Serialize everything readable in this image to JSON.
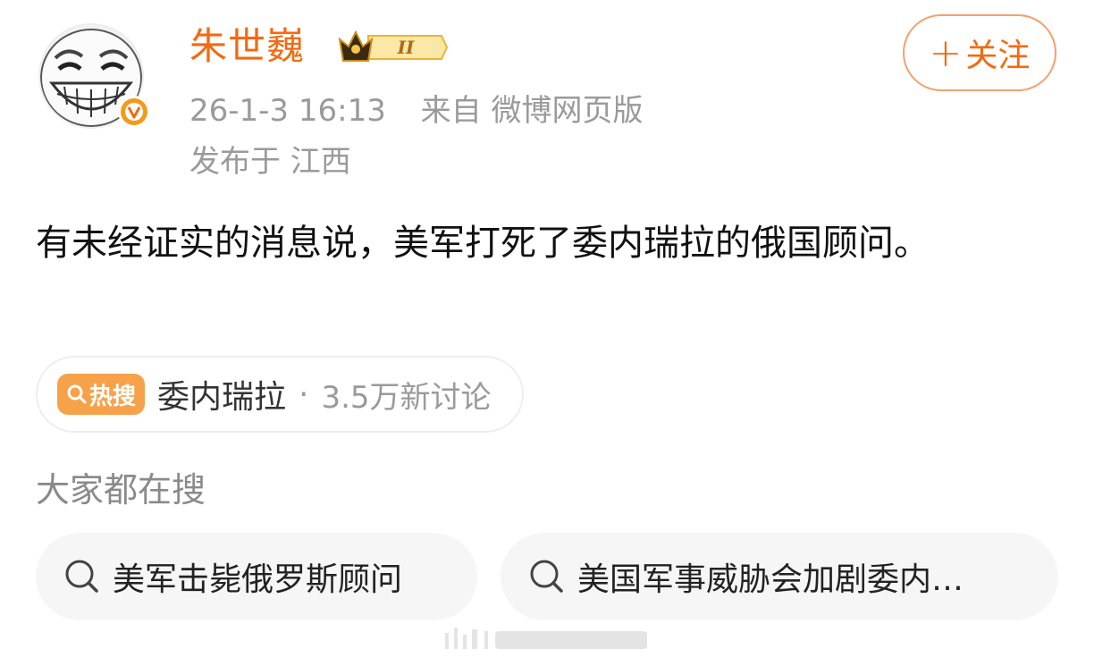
{
  "user": {
    "name": "朱世巍",
    "level_badge": "II",
    "verified_badge": "V",
    "follow_label": "关注",
    "follow_plus": "+"
  },
  "post_meta": {
    "timestamp": "26-1-3 16:13",
    "source": "来自 微博网页版",
    "location": "发布于 江西"
  },
  "post": {
    "text": "有未经证实的消息说，美军打死了委内瑞拉的俄国顾问。"
  },
  "hot_search": {
    "tag_label": "热搜",
    "topic": "委内瑞拉",
    "separator": "·",
    "count": "3.5万新讨论"
  },
  "related_searches": {
    "title": "大家都在搜",
    "items": [
      {
        "label": "美军击毙俄罗斯顾问"
      },
      {
        "label": "美国军事威胁会加剧委内…"
      }
    ]
  },
  "colors": {
    "accent": "#f26a10",
    "hot_tag": "#f6a24a",
    "muted": "#9a9a9a"
  }
}
